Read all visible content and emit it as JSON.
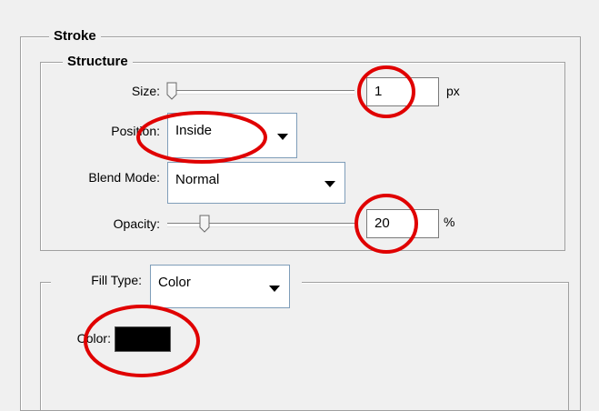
{
  "stroke": {
    "legend": "Stroke",
    "structure": {
      "legend": "Structure",
      "size": {
        "label": "Size:",
        "value": "1",
        "unit": "px",
        "slider_value": 1
      },
      "position": {
        "label": "Position:",
        "value": "Inside"
      },
      "blend_mode": {
        "label": "Blend Mode:",
        "value": "Normal"
      },
      "opacity": {
        "label": "Opacity:",
        "value": "20",
        "unit": "%",
        "slider_value": 20
      }
    },
    "fill": {
      "type_label": "Fill Type:",
      "type_value": "Color",
      "color_label": "Color:",
      "color_value": "#000000"
    }
  },
  "annotation_color": "#e00000"
}
